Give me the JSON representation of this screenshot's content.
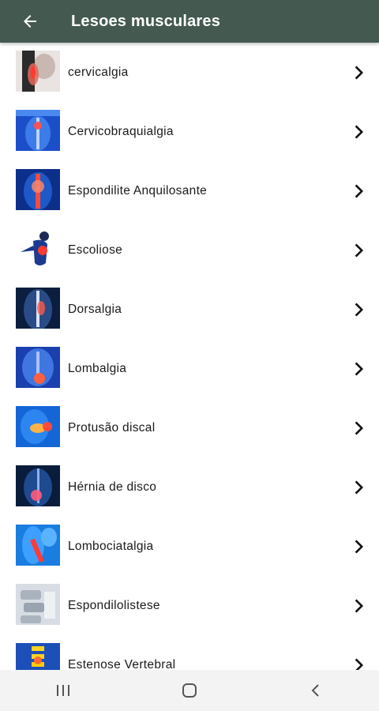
{
  "app_bar": {
    "title": "Lesoes musculares",
    "back_icon": "arrow-left-icon",
    "background": "#445a51"
  },
  "items": [
    {
      "label": "cervicalgia",
      "thumb_style": "light-neck"
    },
    {
      "label": "Cervicobraquialgia",
      "thumb_style": "blue-spine"
    },
    {
      "label": "Espondilite Anquilosante",
      "thumb_style": "blue-red-spine"
    },
    {
      "label": "Escoliose",
      "thumb_style": "white-figure"
    },
    {
      "label": "Dorsalgia",
      "thumb_style": "dark-back"
    },
    {
      "label": "Lombalgia",
      "thumb_style": "blue-lower-back"
    },
    {
      "label": "Protusão discal",
      "thumb_style": "blue-disc"
    },
    {
      "label": "Hérnia de disco",
      "thumb_style": "dark-disc"
    },
    {
      "label": "Lombociatalgia",
      "thumb_style": "blue-leg"
    },
    {
      "label": "Espondilolistese",
      "thumb_style": "gray-vertebra"
    },
    {
      "label": "Estenose Vertebral",
      "thumb_style": "blue-yellow-spine"
    }
  ],
  "nav_bar": {
    "recents_icon": "recents-icon",
    "home_icon": "home-icon",
    "back_icon": "nav-back-icon"
  }
}
